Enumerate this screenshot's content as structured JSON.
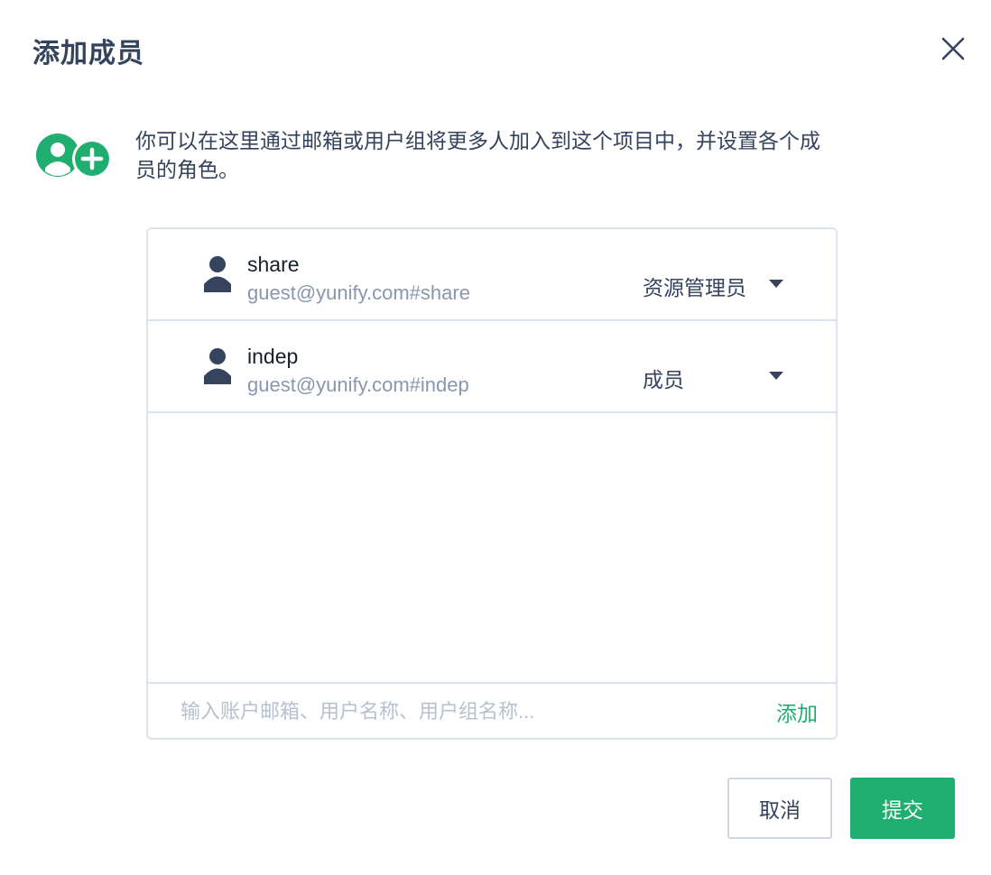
{
  "dialog": {
    "title": "添加成员",
    "intro": "你可以在这里通过邮箱或用户组将更多人加入到这个项目中，并设置各个成员的角色。"
  },
  "members": [
    {
      "name": "share",
      "email": "guest@yunify.com#share",
      "role": "资源管理员"
    },
    {
      "name": "indep",
      "email": "guest@yunify.com#indep",
      "role": "成员"
    }
  ],
  "input": {
    "value": "",
    "placeholder": "输入账户邮箱、用户名称、用户组名称...",
    "add_label": "添加"
  },
  "buttons": {
    "cancel": "取消",
    "submit": "提交"
  },
  "colors": {
    "accent": "#1fae70",
    "text": "#36435c",
    "muted": "#8a96ab",
    "border": "#dde3ec"
  },
  "icons": {
    "close": "close-icon",
    "intro": "add-user-icon",
    "avatar": "user-icon",
    "caret": "caret-down-icon"
  }
}
